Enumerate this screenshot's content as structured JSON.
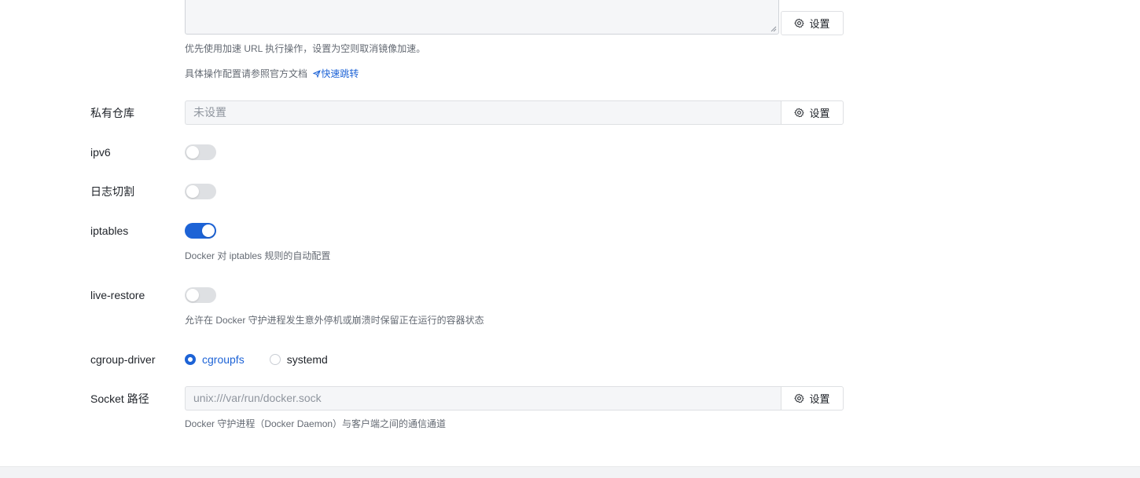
{
  "colors": {
    "accent": "#1d63d6",
    "switch_off": "#dee0e3",
    "hint": "#646a73"
  },
  "mirror": {
    "setting_label": "设置",
    "hint": "优先使用加速 URL 执行操作，设置为空则取消镜像加速。",
    "doc_text": "具体操作配置请参照官方文档",
    "doc_link": "快速跳转"
  },
  "registry": {
    "label": "私有仓库",
    "value": "未设置",
    "setting_label": "设置"
  },
  "ipv6": {
    "label": "ipv6",
    "enabled": false
  },
  "log_rotate": {
    "label": "日志切割",
    "enabled": false
  },
  "iptables": {
    "label": "iptables",
    "enabled": true,
    "hint": "Docker 对 iptables 规则的自动配置"
  },
  "live_restore": {
    "label": "live-restore",
    "enabled": false,
    "hint": "允许在 Docker 守护进程发生意外停机或崩溃时保留正在运行的容器状态"
  },
  "cgroup": {
    "label": "cgroup-driver",
    "options": [
      "cgroupfs",
      "systemd"
    ],
    "selected": "cgroupfs"
  },
  "socket": {
    "label": "Socket 路径",
    "value": "unix:///var/run/docker.sock",
    "setting_label": "设置",
    "hint": "Docker 守护进程（Docker Daemon）与客户端之间的通信通道"
  }
}
